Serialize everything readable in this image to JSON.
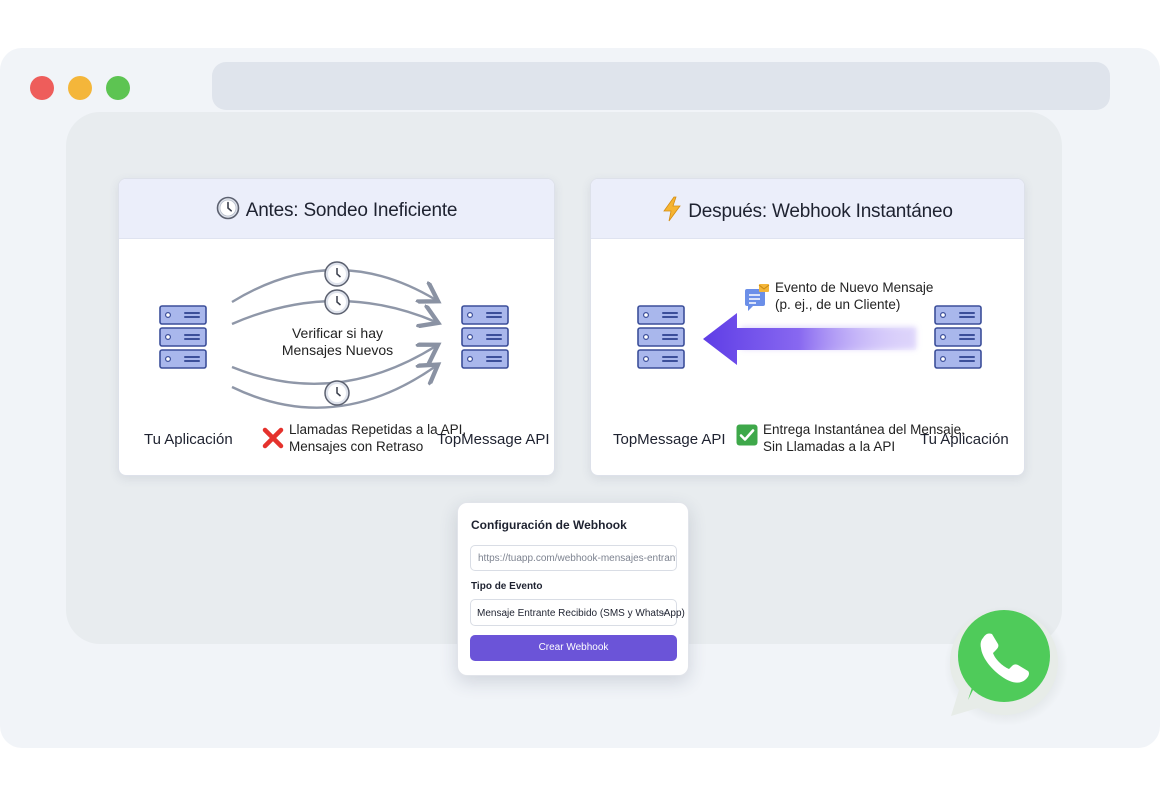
{
  "window": {
    "controls": [
      "close",
      "minimize",
      "maximize"
    ],
    "address_bar": ""
  },
  "before_panel": {
    "title": "Antes: Sondeo Ineficiente",
    "icon": "clock-icon",
    "left_server_label": "Tu Aplicación",
    "right_server_label": "TopMessage API",
    "center_text_line1": "Verificar si hay",
    "center_text_line2": "Mensajes Nuevos",
    "result_icon": "red-x-icon",
    "result_line1": "Llamadas Repetidas a la API,",
    "result_line2": "Mensajes con Retraso"
  },
  "after_panel": {
    "title": "Después: Webhook Instantáneo",
    "icon": "lightning-icon",
    "left_server_label": "TopMessage API",
    "right_server_label": "Tu Aplicación",
    "event_line1": "Evento de Nuevo Mensaje",
    "event_line2": "(p. ej., de un Cliente)",
    "event_icon": "message-notification-icon",
    "result_icon": "green-check-icon",
    "result_line1": "Entrega Instantánea del Mensaje,",
    "result_line2": "Sin Llamadas a la API"
  },
  "webhook_form": {
    "title": "Configuración de Webhook",
    "url_placeholder": "https://tuapp.com/webhook-mensajes-entrantes",
    "event_type_label": "Tipo de Evento",
    "event_type_selected": "Mensaje Entrante Recibido (SMS y WhatsApp)",
    "create_button": "Crear Webhook"
  },
  "badge": {
    "icon": "whatsapp-icon"
  },
  "colors": {
    "window_bg": "#f1f4f8",
    "panel_header": "#ebeefa",
    "accent_purple": "#6b54d8",
    "whatsapp_green": "#4fcb5a",
    "server_blue": "#9fb0e6"
  }
}
